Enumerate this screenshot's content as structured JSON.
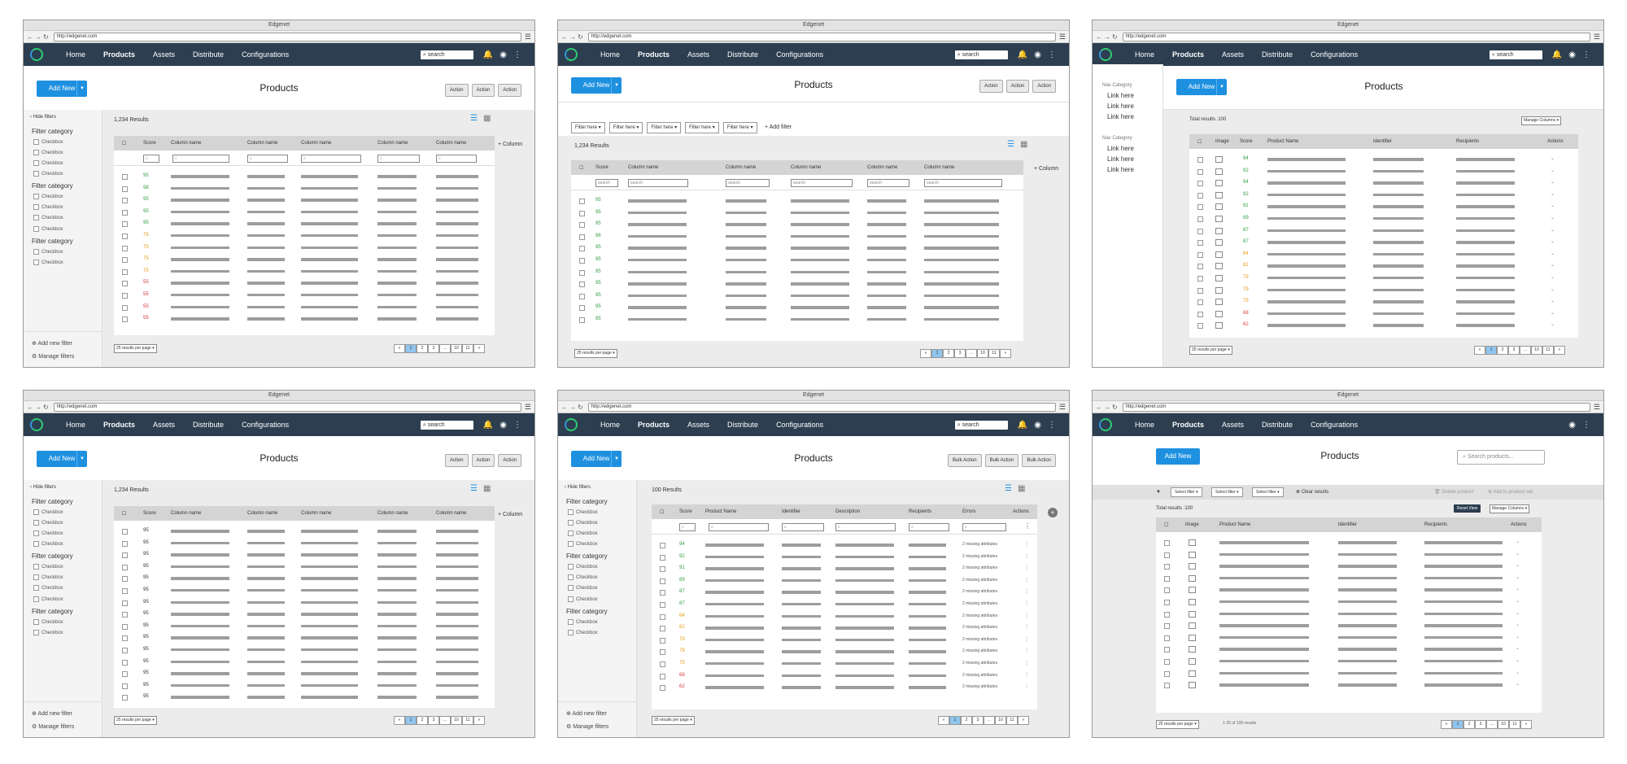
{
  "browser": {
    "title": "Edgenet",
    "url": "http://edgenet.com",
    "url_b": "http://edgenet.com",
    "url_c": "http://edgenet.com"
  },
  "nav": {
    "items": [
      "Home",
      "Products",
      "Assets",
      "Distribute",
      "Configurations"
    ],
    "search": "search"
  },
  "page": {
    "title": "Products",
    "add_new": "Add New",
    "action": "Action",
    "bulk_action": "Bulk Action",
    "search_products": "Search products..."
  },
  "filters": {
    "hide": "Hide filters",
    "category": "Filter category",
    "checkbox": "Checkbox",
    "add_new": "Add new filter",
    "manage": "Manage filters",
    "filter_here": "Filter here",
    "add_filter": "Add filter",
    "select_filter": "Select filter",
    "clear_results": "Clear results",
    "delete_product": "Delete product",
    "add_to_set": "Add to product set"
  },
  "table": {
    "results": "1,234 Results",
    "results_100": "100 Results",
    "total_100": "Total results :100",
    "score": "Score",
    "column_name": "Column name",
    "column_btn": "Column",
    "image": "Image",
    "product_name": "Product Name",
    "identifier": "Identifier",
    "description": "Description",
    "recipients": "Recipients",
    "errors": "Errors",
    "actions": "Actions",
    "search": "search",
    "missing": "2 missing attributes",
    "manage_columns": "Manage Columns",
    "reset_view": "Reset View",
    "count_text": "1-25 of 100 results"
  },
  "pager": {
    "per_page": "25 results per page",
    "pages": [
      "«",
      "1",
      "2",
      "3",
      "...",
      "10",
      "11",
      "»"
    ]
  },
  "nav_category": {
    "label": "Nav Category",
    "link": "Link here"
  },
  "scores": {
    "f1": [
      "95",
      "98",
      "95",
      "95",
      "95",
      "75",
      "75",
      "75",
      "75",
      "55",
      "55",
      "55",
      "55"
    ],
    "f2": [
      "95",
      "95",
      "95",
      "96",
      "95",
      "95",
      "95",
      "95",
      "95",
      "95",
      "95"
    ],
    "f3": [
      "94",
      "92",
      "94",
      "92",
      "91",
      "89",
      "87",
      "87",
      "84",
      "82",
      "79",
      "79",
      "75",
      "68",
      "62"
    ],
    "f4": [
      "95",
      "95",
      "95",
      "95",
      "95",
      "95",
      "95",
      "95",
      "95",
      "95",
      "95",
      "95",
      "95",
      "95",
      "95"
    ],
    "f5": [
      "94",
      "92",
      "91",
      "89",
      "87",
      "87",
      "84",
      "82",
      "79",
      "79",
      "75",
      "68",
      "62"
    ]
  }
}
